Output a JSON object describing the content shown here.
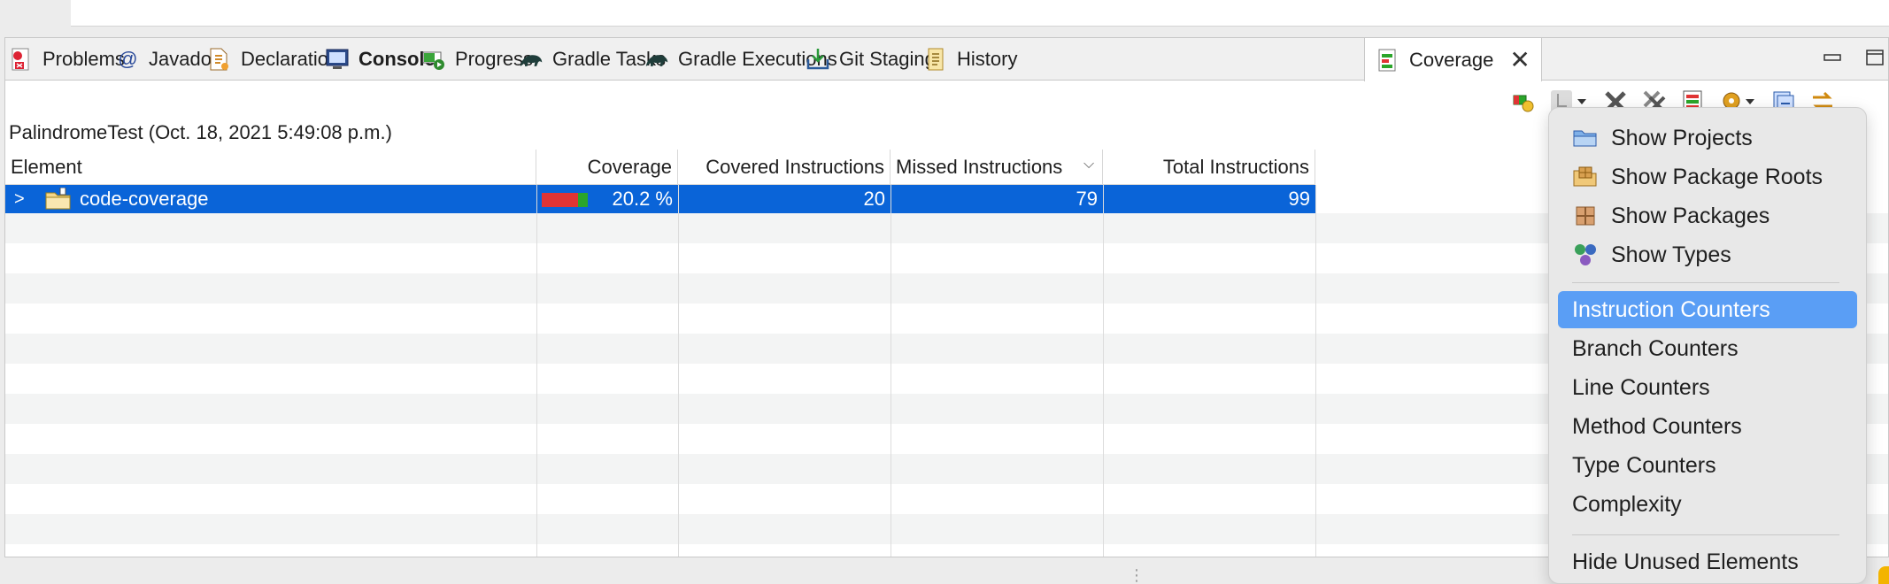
{
  "tabs": [
    {
      "label": "Problems",
      "icon": "problems-icon"
    },
    {
      "label": "Javadoc",
      "icon": "javadoc-icon"
    },
    {
      "label": "Declaration",
      "icon": "declaration-icon"
    },
    {
      "label": "Console",
      "icon": "console-icon"
    },
    {
      "label": "Progress",
      "icon": "progress-icon"
    },
    {
      "label": "Gradle Tasks",
      "icon": "gradle-icon"
    },
    {
      "label": "Gradle Executions",
      "icon": "gradle-icon"
    },
    {
      "label": "Git Staging",
      "icon": "git-staging-icon"
    },
    {
      "label": "History",
      "icon": "history-icon"
    },
    {
      "label": "Coverage",
      "icon": "coverage-icon"
    }
  ],
  "session_title": "PalindromeTest (Oct. 18, 2021 5:49:08 p.m.)",
  "table": {
    "columns": [
      "Element",
      "Coverage",
      "Covered Instructions",
      "Missed Instructions",
      "Total Instructions"
    ],
    "rows": [
      {
        "element": "code-coverage",
        "coverage": "20.2 %",
        "coverage_fraction": 0.202,
        "covered": "20",
        "missed": "79",
        "total": "99"
      }
    ]
  },
  "menu": {
    "group1": [
      "Show Projects",
      "Show Package Roots",
      "Show Packages",
      "Show Types"
    ],
    "group2": [
      "Instruction Counters",
      "Branch Counters",
      "Line Counters",
      "Method Counters",
      "Type Counters",
      "Complexity"
    ],
    "group3": [
      "Hide Unused Elements"
    ],
    "highlighted": "Instruction Counters"
  },
  "colors": {
    "selection": "#0a64d8",
    "menu_highlight": "#5a9ef5",
    "coverage_hit": "#2aa52a",
    "coverage_miss": "#e03434"
  }
}
